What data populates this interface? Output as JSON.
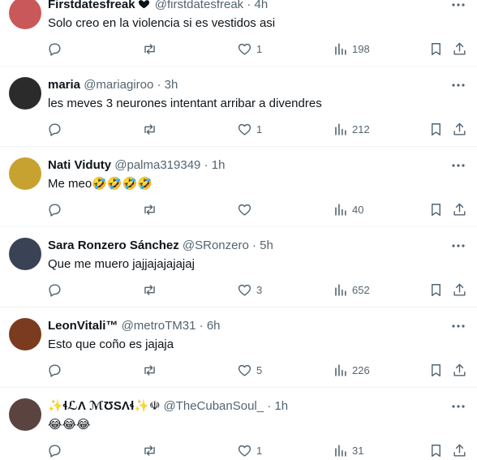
{
  "accent": "#1d9bf0",
  "text_secondary": "#536471",
  "icons": {
    "reply": "reply-bubble-icon",
    "retweet": "retweet-icon",
    "like": "heart-icon",
    "views": "views-bar-icon",
    "bookmark": "bookmark-icon",
    "share": "share-icon",
    "more": "more-dots-icon"
  },
  "tweets": [
    {
      "name": "Firstdatesfreak",
      "badge": "heart",
      "handle": "@firstdatesfreak",
      "sep": "·",
      "time": "4h",
      "text": "Solo creo en la violencia si es vestidos asi",
      "likes": "1",
      "views": "198",
      "avatar_color": "#c9585a"
    },
    {
      "name": "maria",
      "handle": "@mariagiroo",
      "sep": "·",
      "time": "3h",
      "text": "les meves 3 neurones intentant arribar a divendres",
      "likes": "1",
      "views": "212",
      "avatar_color": "#2b2b2b"
    },
    {
      "name": "Nati Viduty",
      "handle": "@palma319349",
      "sep": "·",
      "time": "1h",
      "text": "Me meo🤣🤣🤣🤣",
      "likes": "",
      "views": "40",
      "avatar_color": "#c8a230"
    },
    {
      "name": "Sara Ronzero Sánchez",
      "handle": "@SRonzero",
      "sep": "·",
      "time": "5h",
      "text": "Que me muero jajjajajajajaj",
      "likes": "3",
      "views": "652",
      "avatar_color": "#3a4256"
    },
    {
      "name": "LeonVitali™",
      "handle": "@metroTM31",
      "sep": "·",
      "time": "6h",
      "text": "Esto que coño es jajaja",
      "likes": "5",
      "views": "226",
      "avatar_color": "#7a3b1e"
    },
    {
      "name": "✨ɬℒΛ ℳƱЅΛɬ✨☫",
      "handle": "@TheCubanSoul_",
      "sep": "·",
      "time": "1h",
      "text": "😂😂😂",
      "likes": "1",
      "views": "31",
      "avatar_color": "#5b4440"
    }
  ]
}
